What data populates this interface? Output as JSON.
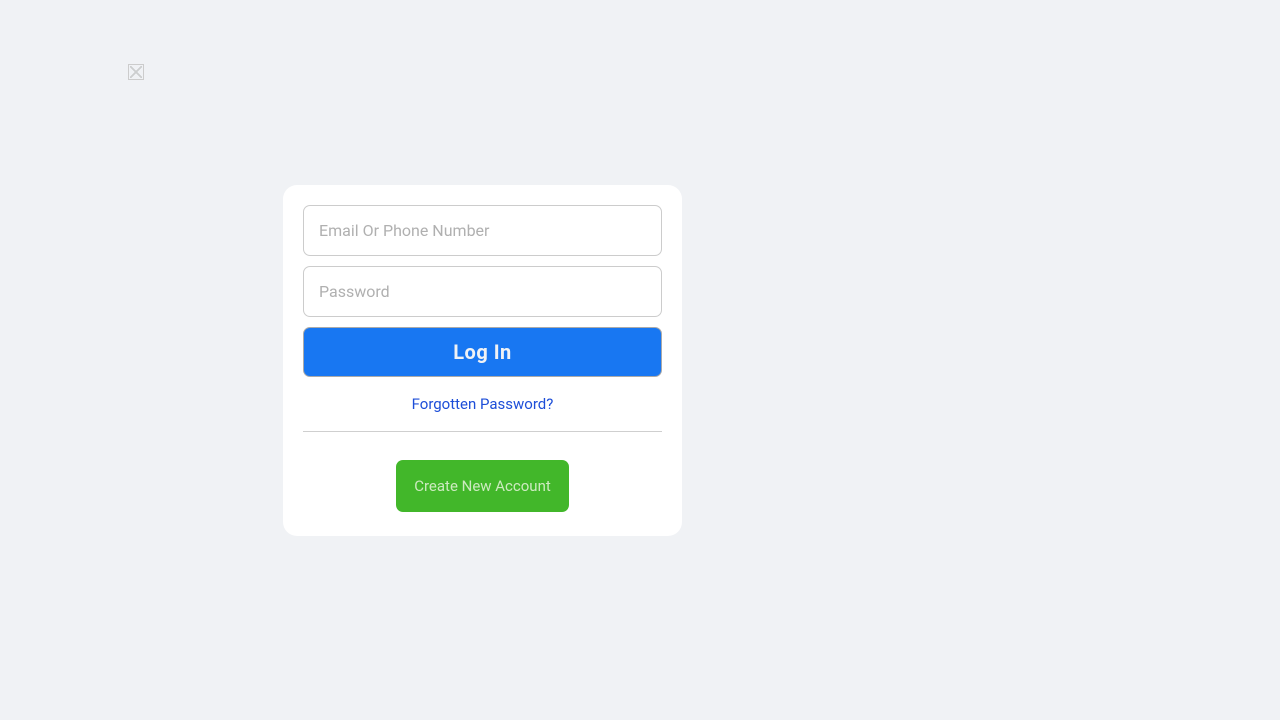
{
  "logo": {
    "alt": "logo"
  },
  "form": {
    "email_placeholder": "Email Or Phone Number",
    "password_placeholder": "Password",
    "login_label": "Log In",
    "forgot_label": "Forgotten Password?",
    "create_label": "Create New Account"
  },
  "colors": {
    "page_bg": "#f0f2f5",
    "card_bg": "#ffffff",
    "primary": "#1877f2",
    "success": "#42b72a",
    "link": "#1d4ed8"
  }
}
